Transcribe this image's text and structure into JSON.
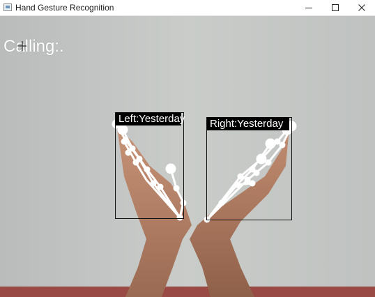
{
  "window": {
    "title": "Hand Gesture Recognition",
    "icon": "app-window-icon",
    "controls": [
      "minimize-icon",
      "maximize-icon",
      "close-icon"
    ]
  },
  "overlay": {
    "gesture_text": "Calling:.",
    "left_hand_label": "Left:Yesterday",
    "right_hand_label": "Right:Yesterday",
    "box_color": "#111111",
    "landmark_color": "#ffffff"
  }
}
